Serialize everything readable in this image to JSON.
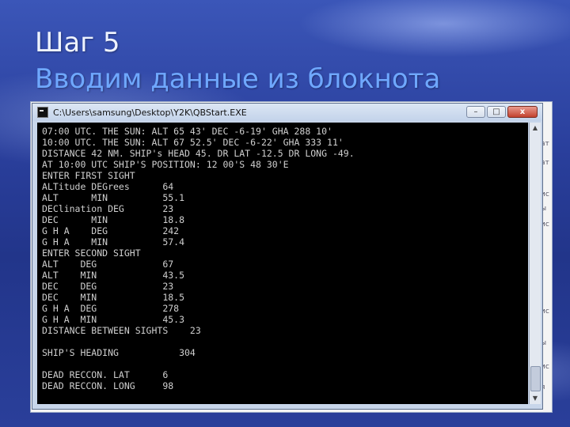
{
  "slide": {
    "title_line1": "Шаг 5",
    "title_line2": "Вводим данные из блокнота"
  },
  "console": {
    "window_title": "C:\\Users\\samsung\\Desktop\\Y2K\\QBStart.EXE",
    "controls": {
      "minimize": "–",
      "maximize": "□",
      "close": "x"
    },
    "lines": [
      "07:00 UTC. THE SUN: ALT 65 43' DEC -6-19' GHA 288 10'",
      "10:00 UTC. THE SUN: ALT 67 52.5' DEC -6-22' GHA 333 11'",
      "DISTANCE 42 NM. SHIP's HEAD 45. DR LAT -12.5 DR LONG -49.",
      "AT 10:00 UTC SHIP'S POSITION: 12 00'S 48 30'E",
      "ENTER FIRST SIGHT",
      "ALTitude DEGrees      64",
      "ALT      MIN          55.1",
      "DEClination DEG       23",
      "DEC      MIN          18.8",
      "G H A    DEG          242",
      "G H A    MIN          57.4",
      "ENTER SECOND SIGHT",
      "ALT    DEG            67",
      "ALT    MIN            43.5",
      "DEC    DEG            23",
      "DEC    MIN            18.5",
      "G H A  DEG            278",
      "G H A  MIN            45.3",
      "DISTANCE BETWEEN SIGHTS    23",
      "",
      "SHIP'S HEADING           304",
      "",
      "DEAD RECCON. LAT      6",
      "DEAD RECCON. LONG     98"
    ]
  },
  "background_window": {
    "fragments": [
      "ат",
      "ат",
      "ис",
      "ы",
      "ис",
      "ис",
      "ы",
      "ис",
      "я"
    ]
  },
  "colors": {
    "slide_bg": "#2a3f9c",
    "title1": "#eef3ff",
    "title2": "#6fa8ff",
    "console_bg": "#000000",
    "console_text": "#cfcfcf"
  }
}
